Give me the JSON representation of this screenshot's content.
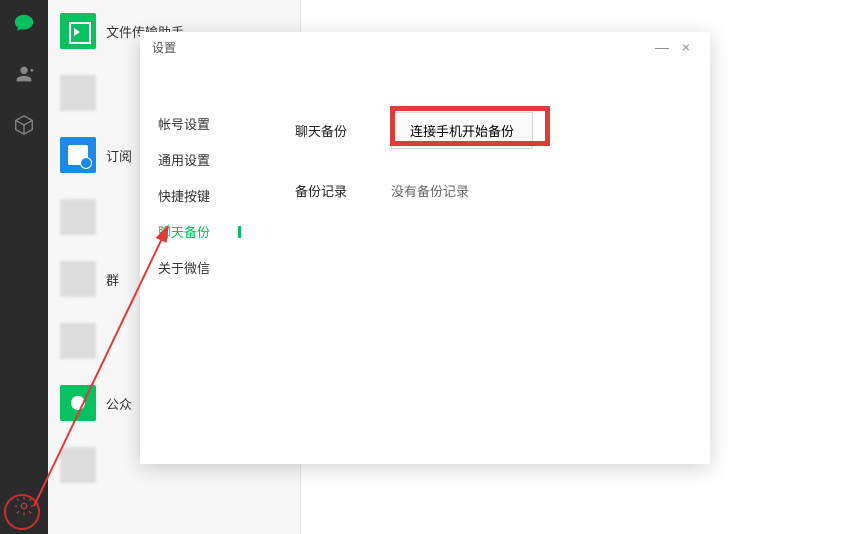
{
  "rail": {
    "chat_icon": "chat-icon",
    "contacts_icon": "contacts-icon",
    "cube_icon": "favorites-icon",
    "gear_icon": "settings-icon"
  },
  "chatlist": {
    "items": [
      {
        "label": "文件传输助手",
        "avatar": "file"
      },
      {
        "label": "",
        "avatar": "blur"
      },
      {
        "label": "订阅",
        "avatar": "sub"
      },
      {
        "label": "",
        "avatar": "blur"
      },
      {
        "label": "群",
        "avatar": "blur"
      },
      {
        "label": "",
        "avatar": "bot"
      },
      {
        "label": "公众",
        "avatar": "pub"
      },
      {
        "label": "",
        "avatar": "blur"
      }
    ]
  },
  "settings": {
    "title": "设置",
    "minimize": "—",
    "close": "×",
    "menu": [
      {
        "label": "帐号设置"
      },
      {
        "label": "通用设置"
      },
      {
        "label": "快捷按键"
      },
      {
        "label": "聊天备份",
        "active": true
      },
      {
        "label": "关于微信"
      }
    ],
    "panel": {
      "row1_label": "聊天备份",
      "row1_button": "连接手机开始备份",
      "row2_label": "备份记录",
      "row2_value": "没有备份记录"
    }
  }
}
